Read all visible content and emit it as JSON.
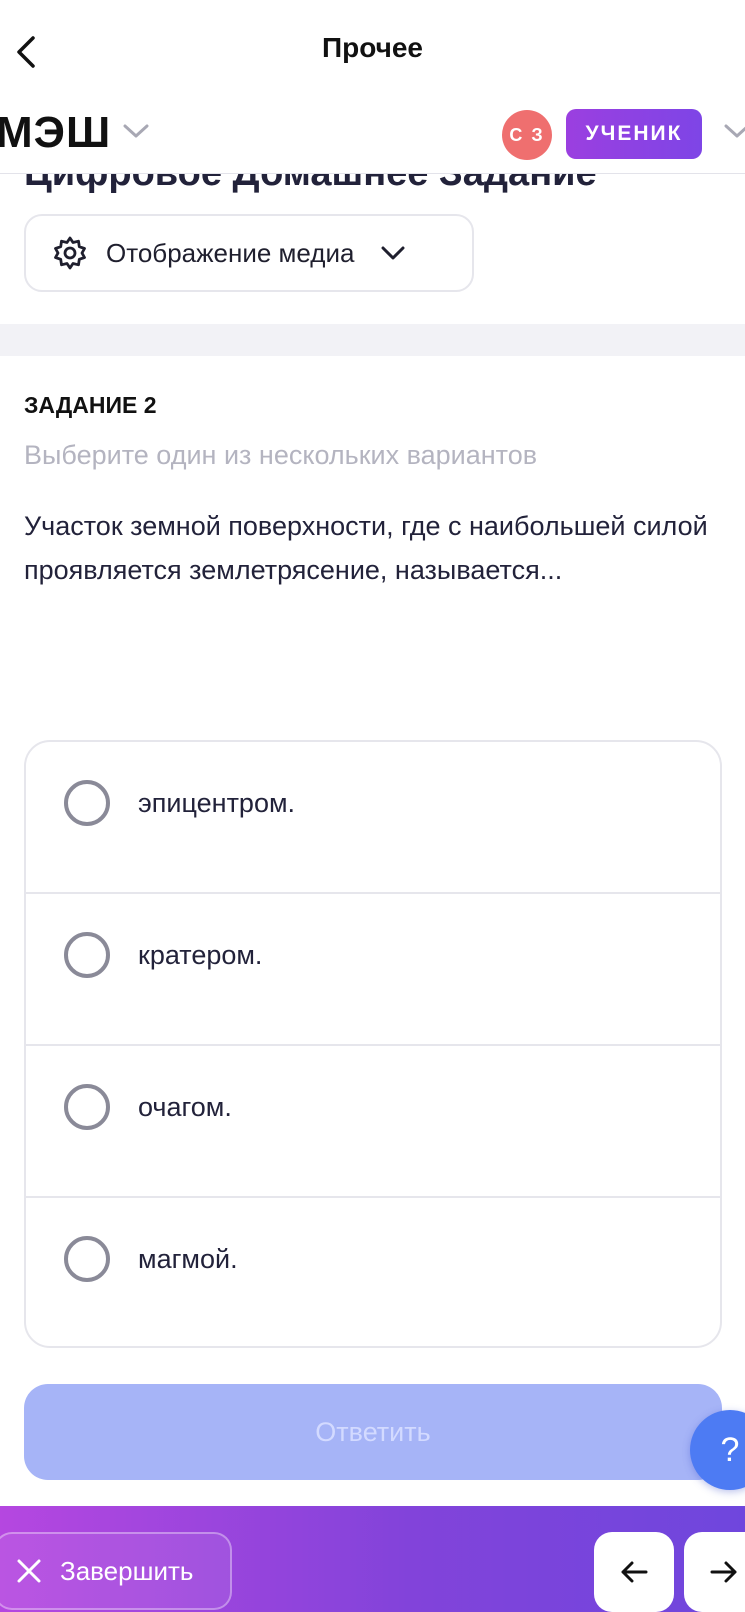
{
  "topbar": {
    "title": "Прочее"
  },
  "header": {
    "logo": "МЭШ",
    "avatar_initials": "С З",
    "role": "УЧЕНИК"
  },
  "course": {
    "title": "Цифровое Домашнее Задание",
    "media_button_label": "Отображение медиа"
  },
  "task": {
    "label": "ЗАДАНИЕ 2",
    "hint": "Выберите один из нескольких вариантов",
    "question": "Участок земной поверхности, где с наибольшей силой проявляется землетрясение, называется...",
    "options": [
      {
        "label": "эпицентром."
      },
      {
        "label": "кратером."
      },
      {
        "label": "очагом."
      },
      {
        "label": "магмой."
      }
    ],
    "submit_label": "Ответить"
  },
  "help": {
    "label": "?"
  },
  "bottombar": {
    "finish_label": "Завершить"
  },
  "colors": {
    "accent_purple": "#8243da",
    "submit_disabled": "#a6b4f7",
    "avatar_red": "#ef6f6f",
    "help_blue": "#4d7bf3"
  }
}
